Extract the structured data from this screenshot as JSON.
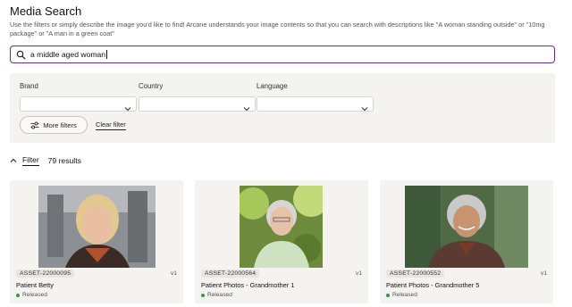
{
  "page": {
    "title": "Media Search",
    "subtitle": "Use the filters or simply describe the image you'd like to find! Arcane understands your image contents so that you can search with descriptions like \"A woman standing outside\" or \"10mg package\" or \"A man in a green coat\""
  },
  "search": {
    "value": "a middle aged woman",
    "icon": "search-icon"
  },
  "filters": {
    "brand_label": "Brand",
    "country_label": "Country",
    "language_label": "Language",
    "more_filters_label": "More filters",
    "clear_filter_label": "Clear filter"
  },
  "results": {
    "filter_toggle_label": "Filter",
    "count_text": "79 results"
  },
  "cards": [
    {
      "asset_id": "ASSET-22000095",
      "version": "v1",
      "name": "Patient Betty",
      "status": "Released"
    },
    {
      "asset_id": "ASSET-22000564",
      "version": "v1",
      "name": "Patient Photos - Grandmother 1",
      "status": "Released"
    },
    {
      "asset_id": "ASSET-22000552",
      "version": "v1",
      "name": "Patient Photos - Grandmother 5",
      "status": "Released"
    }
  ],
  "colors": {
    "accent": "#6e2d86",
    "panel_bg": "#f5f3f0",
    "status_green": "#2e9b4a"
  }
}
